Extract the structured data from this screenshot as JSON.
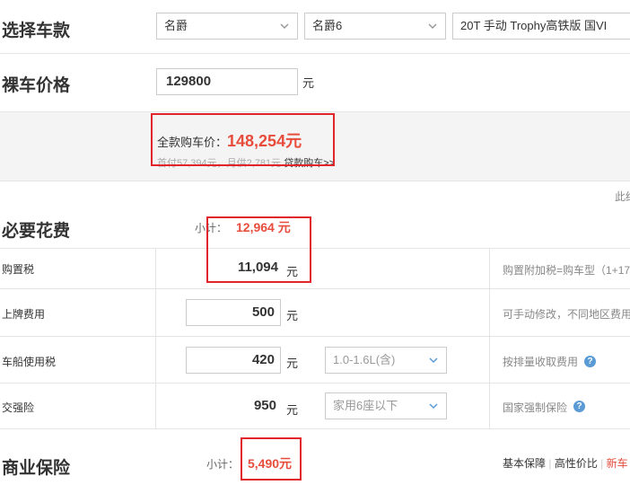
{
  "select_car": {
    "title": "选择车款",
    "brand": "名爵",
    "series": "名爵6",
    "model": "20T 手动 Trophy高铁版 国VI"
  },
  "bare_price": {
    "title": "裸车价格",
    "value": "129800",
    "unit": "元"
  },
  "summary": {
    "total_label": "全款购车价：",
    "total_value": "148,254元",
    "loan_text": "首付57,394元，月供2,781元",
    "loan_link": "贷款购车>>",
    "side_note": "此结"
  },
  "required": {
    "title": "必要花费",
    "subtotal_label": "小计：",
    "subtotal_value": "12,964 元",
    "rows": [
      {
        "label": "购置税",
        "value": "11,094",
        "unit": "元",
        "note": "购置附加税=购车型（1+17"
      },
      {
        "label": "上牌费用",
        "value": "500",
        "unit": "元",
        "note": "可手动修改，不同地区费用"
      },
      {
        "label": "车船使用税",
        "value": "420",
        "unit": "元",
        "select": "1.0-1.6L(含)",
        "note": "按排量收取费用"
      },
      {
        "label": "交强险",
        "value": "950",
        "unit": "元",
        "select": "家用6座以下",
        "note": "国家强制保险"
      }
    ]
  },
  "insurance": {
    "title": "商业保险",
    "subtotal_label": "小计：",
    "subtotal_value": "5,490元",
    "options": [
      "基本保障",
      "高性价比",
      "新车"
    ]
  },
  "colors": {
    "accent_red": "#e74c3c",
    "box_red": "#e0262a",
    "help_blue": "#5b9bd5"
  }
}
